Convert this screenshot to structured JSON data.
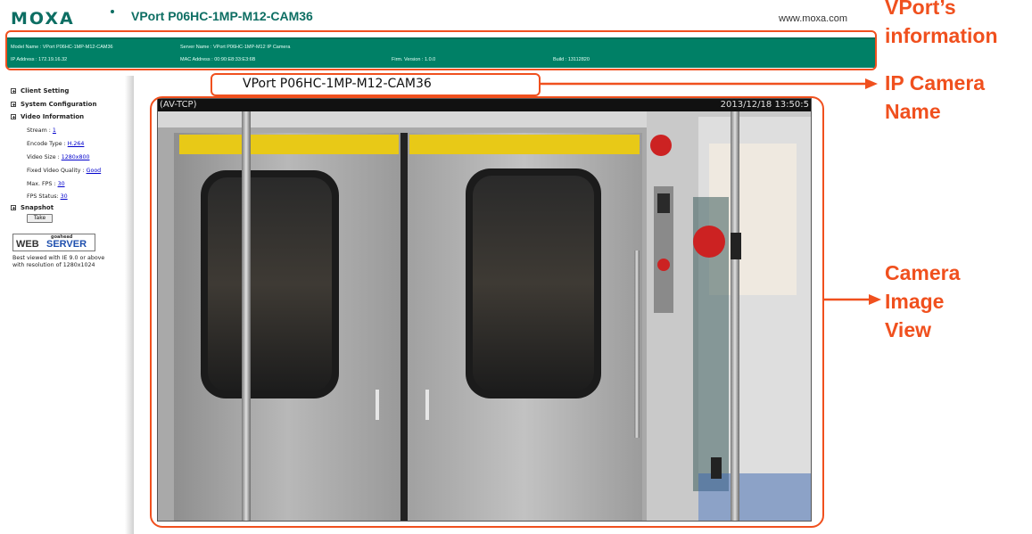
{
  "header": {
    "logo": "MOXA",
    "product_name": "VPort P06HC-1MP-M12-CAM36",
    "website": "www.moxa.com"
  },
  "info_bar": {
    "model_name": "Model Name : VPort P06HC-1MP-M12-CAM36",
    "server_name": "Server Name : VPort P06HC-1MP-M12 IP Camera",
    "ip_address": "IP Address : 172.19.16.32",
    "mac_address": "MAC Address : 00:90:E8:33:E3:6B",
    "firm_version": "Firm. Version : 1.0.0",
    "build": "Build : 13112820"
  },
  "sidebar": {
    "client_setting": "Client Setting",
    "system_configuration": "System Configuration",
    "video_information": "Video Information",
    "stream_label": "Stream : ",
    "stream_value": "1",
    "encode_type_label": "Encode Type : ",
    "encode_type_value": "H.264",
    "video_size_label": "Video Size : ",
    "video_size_value": "1280x800",
    "fixed_quality_label": "Fixed Video Quality : ",
    "fixed_quality_value": "Good",
    "max_fps_label": "Max. FPS : ",
    "max_fps_value": "30",
    "fps_status_label": "FPS Status: ",
    "fps_status_value": "30",
    "snapshot": "Snapshot",
    "take_button": "Take",
    "webserver_small": "goahead",
    "webserver_web": "WEB",
    "webserver_server": "SERVER",
    "best_viewed_line1": "Best viewed with IE 9.0 or above",
    "best_viewed_line2": "with resolution of 1280x1024"
  },
  "camera_name": "VPort P06HC-1MP-M12-CAM36",
  "video": {
    "overlay_left": "(AV-TCP)",
    "overlay_right": "2013/12/18 13:50:5"
  },
  "annotations": {
    "info_line1": "VPort’s",
    "info_line2": "information",
    "name_line1": "IP Camera",
    "name_line2": "Name",
    "view_line1": "Camera",
    "view_line2": "Image",
    "view_line3": "View"
  },
  "colors": {
    "brand_green": "#0d6e63",
    "info_bar": "#008066",
    "annotation_orange": "#f0501e"
  }
}
